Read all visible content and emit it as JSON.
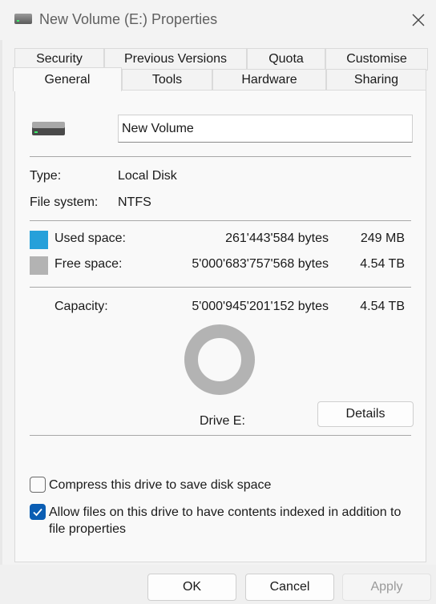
{
  "window": {
    "title": "New Volume (E:) Properties"
  },
  "tabs": {
    "row1": [
      "Security",
      "Previous Versions",
      "Quota",
      "Customise"
    ],
    "row2": [
      "General",
      "Tools",
      "Hardware",
      "Sharing"
    ],
    "active": "General"
  },
  "general": {
    "volume_name": "New Volume",
    "type_label": "Type:",
    "type_value": "Local Disk",
    "fs_label": "File system:",
    "fs_value": "NTFS",
    "used_label": "Used space:",
    "used_bytes": "261'443'584 bytes",
    "used_size": "249 MB",
    "free_label": "Free space:",
    "free_bytes": "5'000'683'757'568 bytes",
    "free_size": "4.54 TB",
    "capacity_label": "Capacity:",
    "capacity_bytes": "5'000'945'201'152 bytes",
    "capacity_size": "4.54 TB",
    "drive_label": "Drive E:",
    "details_button": "Details",
    "used_fraction": 5.23e-05,
    "colors": {
      "used": "#26a0da",
      "free": "#b3b3b3"
    }
  },
  "options": {
    "compress_label": "Compress this drive to save disk space",
    "compress_checked": false,
    "index_label": "Allow files on this drive to have contents indexed in addition to file properties",
    "index_checked": true
  },
  "buttons": {
    "ok": "OK",
    "cancel": "Cancel",
    "apply": "Apply"
  }
}
